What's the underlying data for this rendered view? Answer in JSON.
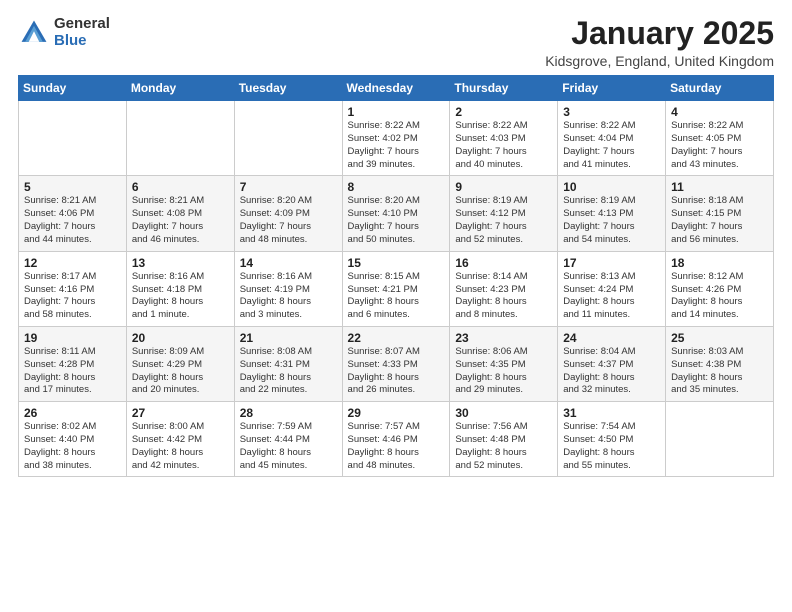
{
  "logo": {
    "general": "General",
    "blue": "Blue"
  },
  "title": "January 2025",
  "location": "Kidsgrove, England, United Kingdom",
  "days_of_week": [
    "Sunday",
    "Monday",
    "Tuesday",
    "Wednesday",
    "Thursday",
    "Friday",
    "Saturday"
  ],
  "weeks": [
    [
      {
        "day": "",
        "info": ""
      },
      {
        "day": "",
        "info": ""
      },
      {
        "day": "",
        "info": ""
      },
      {
        "day": "1",
        "info": "Sunrise: 8:22 AM\nSunset: 4:02 PM\nDaylight: 7 hours\nand 39 minutes."
      },
      {
        "day": "2",
        "info": "Sunrise: 8:22 AM\nSunset: 4:03 PM\nDaylight: 7 hours\nand 40 minutes."
      },
      {
        "day": "3",
        "info": "Sunrise: 8:22 AM\nSunset: 4:04 PM\nDaylight: 7 hours\nand 41 minutes."
      },
      {
        "day": "4",
        "info": "Sunrise: 8:22 AM\nSunset: 4:05 PM\nDaylight: 7 hours\nand 43 minutes."
      }
    ],
    [
      {
        "day": "5",
        "info": "Sunrise: 8:21 AM\nSunset: 4:06 PM\nDaylight: 7 hours\nand 44 minutes."
      },
      {
        "day": "6",
        "info": "Sunrise: 8:21 AM\nSunset: 4:08 PM\nDaylight: 7 hours\nand 46 minutes."
      },
      {
        "day": "7",
        "info": "Sunrise: 8:20 AM\nSunset: 4:09 PM\nDaylight: 7 hours\nand 48 minutes."
      },
      {
        "day": "8",
        "info": "Sunrise: 8:20 AM\nSunset: 4:10 PM\nDaylight: 7 hours\nand 50 minutes."
      },
      {
        "day": "9",
        "info": "Sunrise: 8:19 AM\nSunset: 4:12 PM\nDaylight: 7 hours\nand 52 minutes."
      },
      {
        "day": "10",
        "info": "Sunrise: 8:19 AM\nSunset: 4:13 PM\nDaylight: 7 hours\nand 54 minutes."
      },
      {
        "day": "11",
        "info": "Sunrise: 8:18 AM\nSunset: 4:15 PM\nDaylight: 7 hours\nand 56 minutes."
      }
    ],
    [
      {
        "day": "12",
        "info": "Sunrise: 8:17 AM\nSunset: 4:16 PM\nDaylight: 7 hours\nand 58 minutes."
      },
      {
        "day": "13",
        "info": "Sunrise: 8:16 AM\nSunset: 4:18 PM\nDaylight: 8 hours\nand 1 minute."
      },
      {
        "day": "14",
        "info": "Sunrise: 8:16 AM\nSunset: 4:19 PM\nDaylight: 8 hours\nand 3 minutes."
      },
      {
        "day": "15",
        "info": "Sunrise: 8:15 AM\nSunset: 4:21 PM\nDaylight: 8 hours\nand 6 minutes."
      },
      {
        "day": "16",
        "info": "Sunrise: 8:14 AM\nSunset: 4:23 PM\nDaylight: 8 hours\nand 8 minutes."
      },
      {
        "day": "17",
        "info": "Sunrise: 8:13 AM\nSunset: 4:24 PM\nDaylight: 8 hours\nand 11 minutes."
      },
      {
        "day": "18",
        "info": "Sunrise: 8:12 AM\nSunset: 4:26 PM\nDaylight: 8 hours\nand 14 minutes."
      }
    ],
    [
      {
        "day": "19",
        "info": "Sunrise: 8:11 AM\nSunset: 4:28 PM\nDaylight: 8 hours\nand 17 minutes."
      },
      {
        "day": "20",
        "info": "Sunrise: 8:09 AM\nSunset: 4:29 PM\nDaylight: 8 hours\nand 20 minutes."
      },
      {
        "day": "21",
        "info": "Sunrise: 8:08 AM\nSunset: 4:31 PM\nDaylight: 8 hours\nand 22 minutes."
      },
      {
        "day": "22",
        "info": "Sunrise: 8:07 AM\nSunset: 4:33 PM\nDaylight: 8 hours\nand 26 minutes."
      },
      {
        "day": "23",
        "info": "Sunrise: 8:06 AM\nSunset: 4:35 PM\nDaylight: 8 hours\nand 29 minutes."
      },
      {
        "day": "24",
        "info": "Sunrise: 8:04 AM\nSunset: 4:37 PM\nDaylight: 8 hours\nand 32 minutes."
      },
      {
        "day": "25",
        "info": "Sunrise: 8:03 AM\nSunset: 4:38 PM\nDaylight: 8 hours\nand 35 minutes."
      }
    ],
    [
      {
        "day": "26",
        "info": "Sunrise: 8:02 AM\nSunset: 4:40 PM\nDaylight: 8 hours\nand 38 minutes."
      },
      {
        "day": "27",
        "info": "Sunrise: 8:00 AM\nSunset: 4:42 PM\nDaylight: 8 hours\nand 42 minutes."
      },
      {
        "day": "28",
        "info": "Sunrise: 7:59 AM\nSunset: 4:44 PM\nDaylight: 8 hours\nand 45 minutes."
      },
      {
        "day": "29",
        "info": "Sunrise: 7:57 AM\nSunset: 4:46 PM\nDaylight: 8 hours\nand 48 minutes."
      },
      {
        "day": "30",
        "info": "Sunrise: 7:56 AM\nSunset: 4:48 PM\nDaylight: 8 hours\nand 52 minutes."
      },
      {
        "day": "31",
        "info": "Sunrise: 7:54 AM\nSunset: 4:50 PM\nDaylight: 8 hours\nand 55 minutes."
      },
      {
        "day": "",
        "info": ""
      }
    ]
  ]
}
